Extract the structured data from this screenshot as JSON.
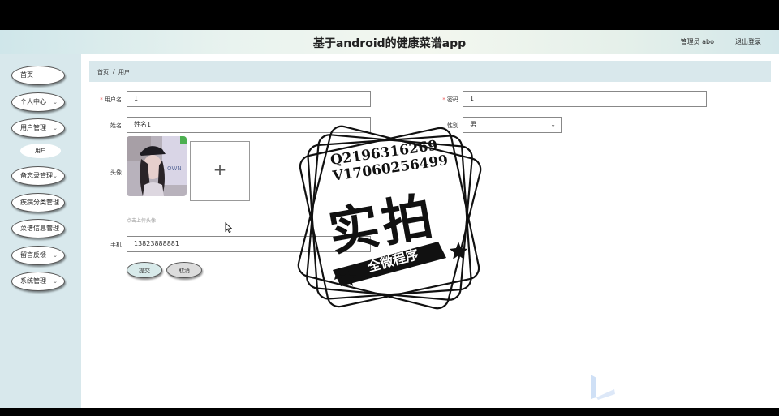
{
  "header": {
    "title": "基于android的健康菜谱app",
    "admin_label": "管理员 abo",
    "logout_label": "退出登录"
  },
  "sidebar": {
    "items": [
      {
        "label": "首页"
      },
      {
        "label": "个人中心"
      },
      {
        "label": "用户管理"
      },
      {
        "label": "用户"
      },
      {
        "label": "备忘录管理"
      },
      {
        "label": "疾病分类管理"
      },
      {
        "label": "菜谱信息管理"
      },
      {
        "label": "留言反馈"
      },
      {
        "label": "系统管理"
      }
    ]
  },
  "breadcrumb": {
    "home": "首页",
    "separator": "/",
    "current": "用户"
  },
  "form": {
    "username": {
      "label": "用户名",
      "required": "*",
      "value": "1"
    },
    "password": {
      "label": "密码",
      "required": "*",
      "value": "1"
    },
    "name": {
      "label": "姓名",
      "value": "姓名1"
    },
    "gender": {
      "label": "性别",
      "value": "男"
    },
    "avatar": {
      "label": "头像",
      "hint": "点击上传头像",
      "add_icon": "+"
    },
    "phone": {
      "label": "手机",
      "value": "13823888881"
    },
    "submit_label": "提交",
    "cancel_label": "取消"
  },
  "watermark": {
    "line1": "Q2196316269",
    "line2": "V17060256499",
    "big": "实拍",
    "ribbon": "全微程序"
  },
  "colors": {
    "sidebar_bg": "#d8e8ec",
    "breadcrumb_bg": "#d9e8ec",
    "required": "#e55555",
    "submit_bg": "#d8eaea",
    "cancel_bg": "#dcdcdc"
  }
}
